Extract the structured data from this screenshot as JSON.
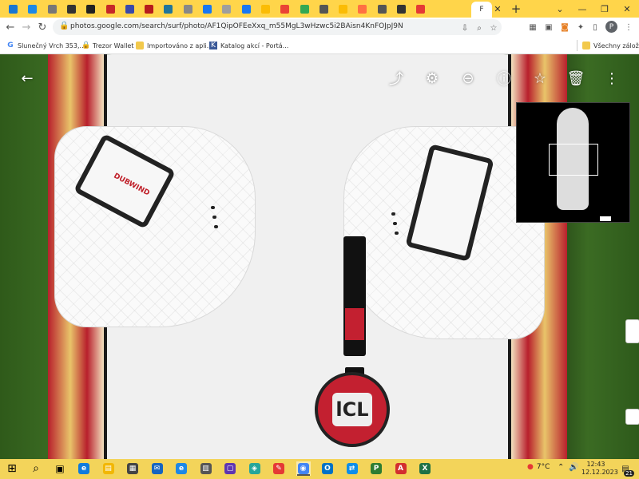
{
  "browser": {
    "tabs": [
      {
        "icon": "wm-favicon",
        "color": "#1976d2",
        "label": "WM"
      },
      {
        "icon": "cloud-favicon",
        "color": "#1e88e5",
        "label": ""
      },
      {
        "icon": "grey-favicon",
        "color": "#777777",
        "label": ""
      },
      {
        "icon": "chevron-favicon",
        "color": "#333333",
        "label": ""
      },
      {
        "icon": "hex-favicon",
        "color": "#222222",
        "label": ""
      },
      {
        "icon": "red-box-favicon",
        "color": "#c62828",
        "label": ""
      },
      {
        "icon": "flag-favicon",
        "color": "#3949ab",
        "label": ""
      },
      {
        "icon": "mb-favicon",
        "color": "#b71c1c",
        "label": "MB"
      },
      {
        "icon": "wordpress-favicon",
        "color": "#21759b",
        "label": ""
      },
      {
        "icon": "mail-favicon",
        "color": "#888888",
        "label": ""
      },
      {
        "icon": "facebook-favicon",
        "color": "#1877f2",
        "label": ""
      },
      {
        "icon": "doc-favicon",
        "color": "#9e9e9e",
        "label": ""
      },
      {
        "icon": "facebook-favicon",
        "color": "#1877f2",
        "label": ""
      },
      {
        "icon": "photos-favicon",
        "color": "#fbbc05",
        "label": ""
      },
      {
        "icon": "google-favicon",
        "color": "#ea4335",
        "label": ""
      },
      {
        "icon": "green-favicon",
        "color": "#34a853",
        "label": ""
      },
      {
        "icon": "circle-favicon",
        "color": "#555555",
        "label": ""
      },
      {
        "icon": "photos-favicon",
        "color": "#fbbc05",
        "label": ""
      },
      {
        "icon": "orange-favicon",
        "color": "#ff7043",
        "label": ""
      },
      {
        "icon": "circle-favicon",
        "color": "#555555",
        "label": ""
      },
      {
        "icon": "github-favicon",
        "color": "#333333",
        "label": ""
      },
      {
        "icon": "red-favicon",
        "color": "#e53935",
        "label": ""
      }
    ],
    "active_tab_label": "F",
    "window_controls": {
      "chevron": "⌄",
      "minimize": "—",
      "restore": "❐",
      "close": "✕"
    },
    "new_tab": "+",
    "tab_close": "✕",
    "url": "photos.google.com/search/surf/photo/AF1QipOFEeXxq_m55MgL3wHzwc5i2BAisn4KnFOJpJ9N",
    "profile_initial": "P",
    "bookmarks": [
      {
        "icon": "google-icon",
        "label": "Slunečný Vrch 353,..."
      },
      {
        "icon": "trezor-icon",
        "label": "Trezor Wallet"
      },
      {
        "icon": "folder-icon",
        "label": "Importováno z apli..."
      },
      {
        "icon": "katalog-icon",
        "label": "Katalog akcí - Portá..."
      },
      {
        "icon": "folder-icon",
        "label": "Všechny záložky"
      }
    ]
  },
  "viewer": {
    "back": "←",
    "toolbar": {
      "share": "⤴",
      "edit": "⚙",
      "zoom_out": "⊖",
      "info": "ⓘ",
      "favorite": "☆",
      "delete": "🗑",
      "more": "⋮"
    },
    "logo_text": "lCL",
    "strap_brand": "DUBWIND"
  },
  "taskbar": {
    "start": "⊞",
    "search": "⌕",
    "task_view": "▣",
    "apps": [
      {
        "name": "edge",
        "color": "#0f7bdc",
        "glyph": "e"
      },
      {
        "name": "explorer",
        "color": "#f2b705",
        "glyph": "▤"
      },
      {
        "name": "store",
        "color": "#444444",
        "glyph": "▦"
      },
      {
        "name": "mail",
        "color": "#1565c0",
        "glyph": "✉"
      },
      {
        "name": "ie",
        "color": "#1e88e5",
        "glyph": "e"
      },
      {
        "name": "calculator",
        "color": "#555555",
        "glyph": "▥"
      },
      {
        "name": "save",
        "color": "#5e35b1",
        "glyph": "▢"
      },
      {
        "name": "network",
        "color": "#26a69a",
        "glyph": "◈"
      },
      {
        "name": "paint",
        "color": "#e53935",
        "glyph": "✎"
      },
      {
        "name": "chrome",
        "color": "#4285f4",
        "glyph": "◉"
      },
      {
        "name": "outlook",
        "color": "#0072c6",
        "glyph": "O"
      },
      {
        "name": "teamviewer",
        "color": "#0e8ee9",
        "glyph": "⇄"
      },
      {
        "name": "green-app",
        "color": "#2e7d32",
        "glyph": "P"
      },
      {
        "name": "acrobat",
        "color": "#d32f2f",
        "glyph": "A"
      },
      {
        "name": "excel",
        "color": "#1e7145",
        "glyph": "X"
      }
    ],
    "weather_temp": "7°C",
    "tray_chevron": "⌃",
    "volume": "🔊",
    "time": "12:43",
    "date": "12.12.2023",
    "notifications_count": "21"
  }
}
